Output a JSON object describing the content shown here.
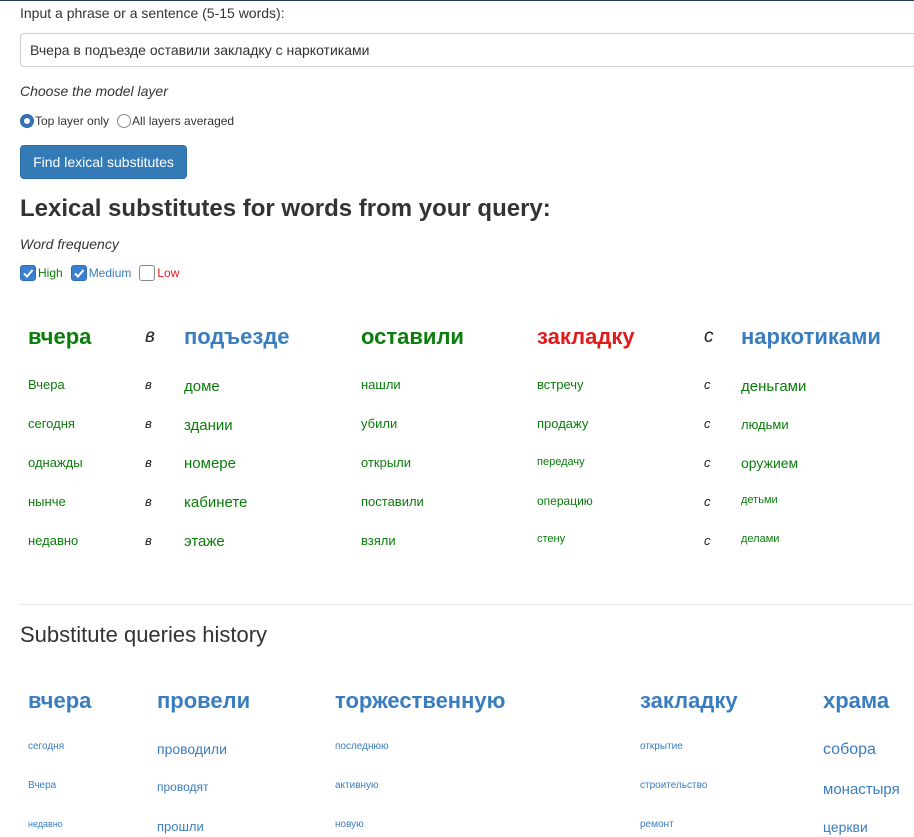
{
  "form": {
    "input_label": "Input a phrase or a sentence (5-15 words):",
    "input_value": "Вчера в подъезде оставили закладку с наркотиками",
    "layer_label": "Choose the model layer",
    "layer_options": [
      "Top layer only",
      "All layers averaged"
    ],
    "layer_selected": "Top layer only",
    "submit_label": "Find lexical substitutes"
  },
  "results": {
    "heading": "Lexical substitutes for words from your query:",
    "frequency_label": "Word frequency",
    "frequency_filters": [
      {
        "label": "High",
        "checked": true,
        "color": "#0a7d0a"
      },
      {
        "label": "Medium",
        "checked": true,
        "color": "#3a7dbf"
      },
      {
        "label": "Low",
        "checked": false,
        "color": "#e11b1b"
      }
    ],
    "columns": [
      {
        "word": "вчера",
        "substitutes": [
          "Вчера",
          "сегодня",
          "однажды",
          "нынче",
          "недавно"
        ]
      },
      {
        "word": "в",
        "substitutes": [
          "в",
          "в",
          "в",
          "в",
          "в"
        ]
      },
      {
        "word": "подъезде",
        "substitutes": [
          "доме",
          "здании",
          "номере",
          "кабинете",
          "этаже"
        ]
      },
      {
        "word": "оставили",
        "substitutes": [
          "нашли",
          "убили",
          "открыли",
          "поставили",
          "взяли"
        ]
      },
      {
        "word": "закладку",
        "substitutes": [
          "встречу",
          "продажу",
          "передачу",
          "операцию",
          "стену"
        ]
      },
      {
        "word": "с",
        "substitutes": [
          "с",
          "с",
          "с",
          "с",
          "с"
        ]
      },
      {
        "word": "наркотиками",
        "substitutes": [
          "деньгами",
          "людьми",
          "оружием",
          "детьми",
          "делами"
        ]
      }
    ]
  },
  "history": {
    "heading": "Substitute queries history",
    "columns": [
      {
        "word": "вчера",
        "substitutes": [
          "сегодня",
          "Вчера",
          "недавно"
        ]
      },
      {
        "word": "провели",
        "substitutes": [
          "проводили",
          "проводят",
          "прошли"
        ]
      },
      {
        "word": "торжественную",
        "substitutes": [
          "последнюю",
          "активную",
          "новую"
        ]
      },
      {
        "word": "закладку",
        "substitutes": [
          "открытие",
          "строительство",
          "ремонт"
        ]
      },
      {
        "word": "храма",
        "substitutes": [
          "собора",
          "монастыря",
          "церкви"
        ]
      }
    ]
  }
}
